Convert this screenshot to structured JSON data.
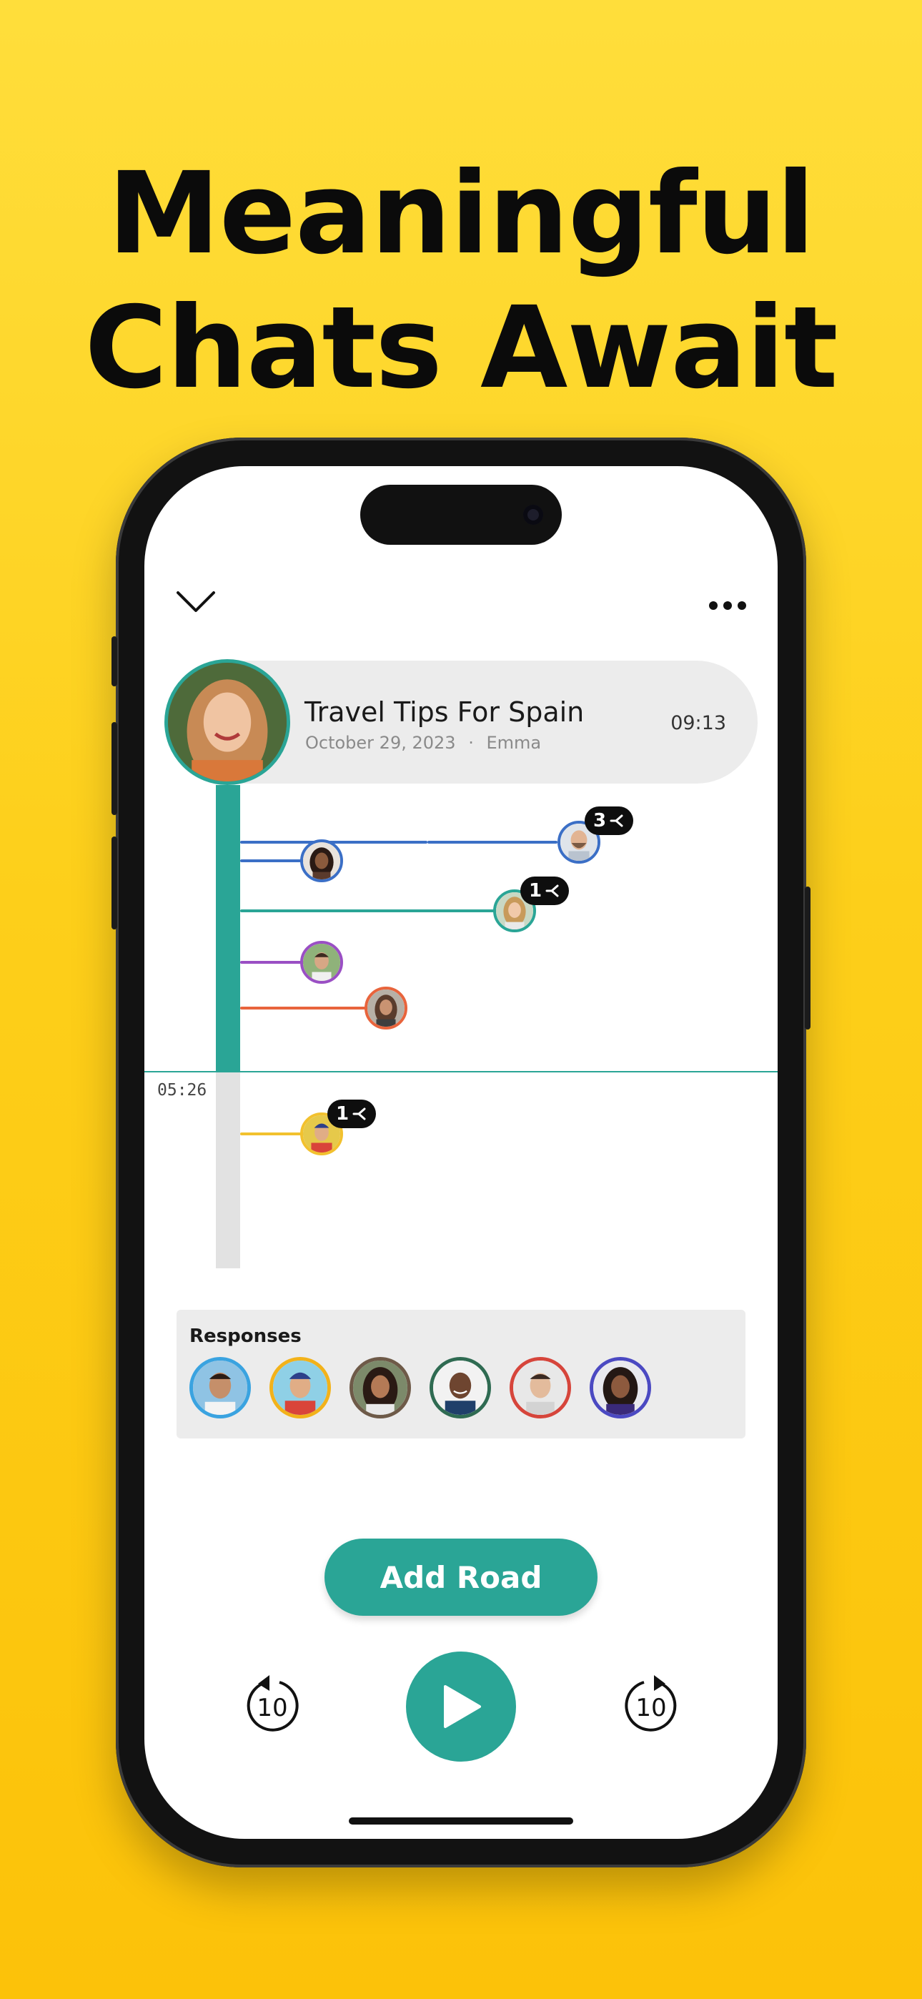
{
  "headline": {
    "line1": "Meaningful",
    "line2": "Chats Await"
  },
  "conversation": {
    "title": "Travel Tips For Spain",
    "date": "October 29, 2023",
    "separator": "·",
    "author": "Emma",
    "duration": "09:13"
  },
  "timeline": {
    "current_time": "05:26",
    "branches": [
      {
        "color": "#3b6fc6",
        "badge": "3"
      },
      {
        "color": "#3b6fc6"
      },
      {
        "color": "#2aa596",
        "badge": "1"
      },
      {
        "color": "#9a4fc4"
      },
      {
        "color": "#e8643c"
      },
      {
        "color": "#f2c12e",
        "badge": "1"
      }
    ]
  },
  "responses": {
    "label": "Responses",
    "avatars": [
      {
        "border": "#3aa3e0"
      },
      {
        "border": "#f2b21a"
      },
      {
        "border": "#6e5a48"
      },
      {
        "border": "#2f6b52"
      },
      {
        "border": "#d6453b"
      },
      {
        "border": "#4b49c2"
      }
    ]
  },
  "actions": {
    "add_road": "Add Road",
    "rewind": "10",
    "forward": "10"
  },
  "colors": {
    "accent": "#2aa596",
    "background": "#FDCF1A"
  }
}
